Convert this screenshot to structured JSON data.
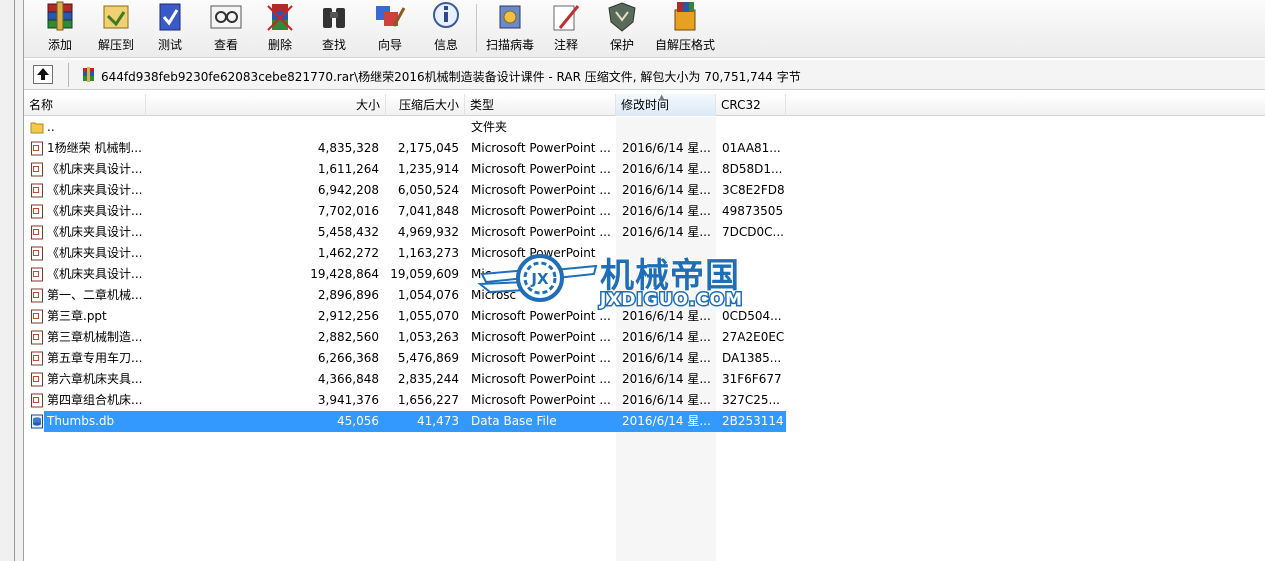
{
  "toolbar": {
    "buttons": [
      {
        "label": "添加"
      },
      {
        "label": "解压到"
      },
      {
        "label": "测试"
      },
      {
        "label": "查看"
      },
      {
        "label": "删除"
      },
      {
        "label": "查找"
      },
      {
        "label": "向导"
      },
      {
        "label": "信息"
      },
      {
        "label": "扫描病毒"
      },
      {
        "label": "注释"
      },
      {
        "label": "保护"
      },
      {
        "label": "自解压格式"
      }
    ]
  },
  "address": {
    "path": "644fd938feb9230fe62083cebe821770.rar\\杨继荣2016机械制造装备设计课件 - RAR 压缩文件, 解包大小为 70,751,744 字节"
  },
  "columns": {
    "name": "名称",
    "size": "大小",
    "packed": "压缩后大小",
    "type": "类型",
    "modified": "修改时间",
    "crc": "CRC32"
  },
  "rows": [
    {
      "name": "..",
      "size": "",
      "packed": "",
      "type": "文件夹",
      "modified": "",
      "crc": "",
      "icon": "folder-icon"
    },
    {
      "name": "1杨继荣 机械制...",
      "size": "4,835,328",
      "packed": "2,175,045",
      "type": "Microsoft PowerPoint ...",
      "modified": "2016/6/14 星...",
      "crc": "01AA81...",
      "icon": "ppt-file-icon"
    },
    {
      "name": "《机床夹具设计...",
      "size": "1,611,264",
      "packed": "1,235,914",
      "type": "Microsoft PowerPoint ...",
      "modified": "2016/6/14 星...",
      "crc": "8D58D1...",
      "icon": "ppt-file-icon"
    },
    {
      "name": "《机床夹具设计...",
      "size": "6,942,208",
      "packed": "6,050,524",
      "type": "Microsoft PowerPoint ...",
      "modified": "2016/6/14 星...",
      "crc": "3C8E2FD8",
      "icon": "ppt-file-icon"
    },
    {
      "name": "《机床夹具设计...",
      "size": "7,702,016",
      "packed": "7,041,848",
      "type": "Microsoft PowerPoint ...",
      "modified": "2016/6/14 星...",
      "crc": "49873505",
      "icon": "ppt-file-icon"
    },
    {
      "name": "《机床夹具设计...",
      "size": "5,458,432",
      "packed": "4,969,932",
      "type": "Microsoft PowerPoint ...",
      "modified": "2016/6/14 星...",
      "crc": "7DCD0C...",
      "icon": "ppt-file-icon"
    },
    {
      "name": "《机床夹具设计...",
      "size": "1,462,272",
      "packed": "1,163,273",
      "type": "Microsoft PowerPoint",
      "modified": "",
      "crc": "",
      "icon": "ppt-file-icon"
    },
    {
      "name": "《机床夹具设计...",
      "size": "19,428,864",
      "packed": "19,059,609",
      "type": "Mic",
      "modified": "",
      "crc": "",
      "icon": "ppt-file-icon"
    },
    {
      "name": "第一、二章机械...",
      "size": "2,896,896",
      "packed": "1,054,076",
      "type": "Microsc",
      "modified": "",
      "crc": "",
      "icon": "ppt-file-icon"
    },
    {
      "name": "第三章.ppt",
      "size": "2,912,256",
      "packed": "1,055,070",
      "type": "Microsoft PowerPoint ...",
      "modified": "2016/6/14 星...",
      "crc": "0CD504...",
      "icon": "ppt-file-icon"
    },
    {
      "name": "第三章机械制造...",
      "size": "2,882,560",
      "packed": "1,053,263",
      "type": "Microsoft PowerPoint ...",
      "modified": "2016/6/14 星...",
      "crc": "27A2E0EC",
      "icon": "ppt-file-icon"
    },
    {
      "name": "第五章专用车刀...",
      "size": "6,266,368",
      "packed": "5,476,869",
      "type": "Microsoft PowerPoint ...",
      "modified": "2016/6/14 星...",
      "crc": "DA1385...",
      "icon": "ppt-file-icon"
    },
    {
      "name": "第六章机床夹具...",
      "size": "4,366,848",
      "packed": "2,835,244",
      "type": "Microsoft PowerPoint ...",
      "modified": "2016/6/14 星...",
      "crc": "31F6F677",
      "icon": "ppt-file-icon"
    },
    {
      "name": "第四章组合机床...",
      "size": "3,941,376",
      "packed": "1,656,227",
      "type": "Microsoft PowerPoint ...",
      "modified": "2016/6/14 星...",
      "crc": "327C25...",
      "icon": "ppt-file-icon"
    },
    {
      "name": "Thumbs.db",
      "size": "45,056",
      "packed": "41,473",
      "type": "Data Base File",
      "modified": "2016/6/14 星...",
      "crc": "2B253114",
      "icon": "db-file-icon",
      "selected": true
    }
  ],
  "watermark": {
    "cn": "机械帝国",
    "en": "JXDIGUO.COM",
    "logo": "JX"
  },
  "colors": {
    "selection": "#3399ff",
    "watermark": "#1f6fb8"
  }
}
